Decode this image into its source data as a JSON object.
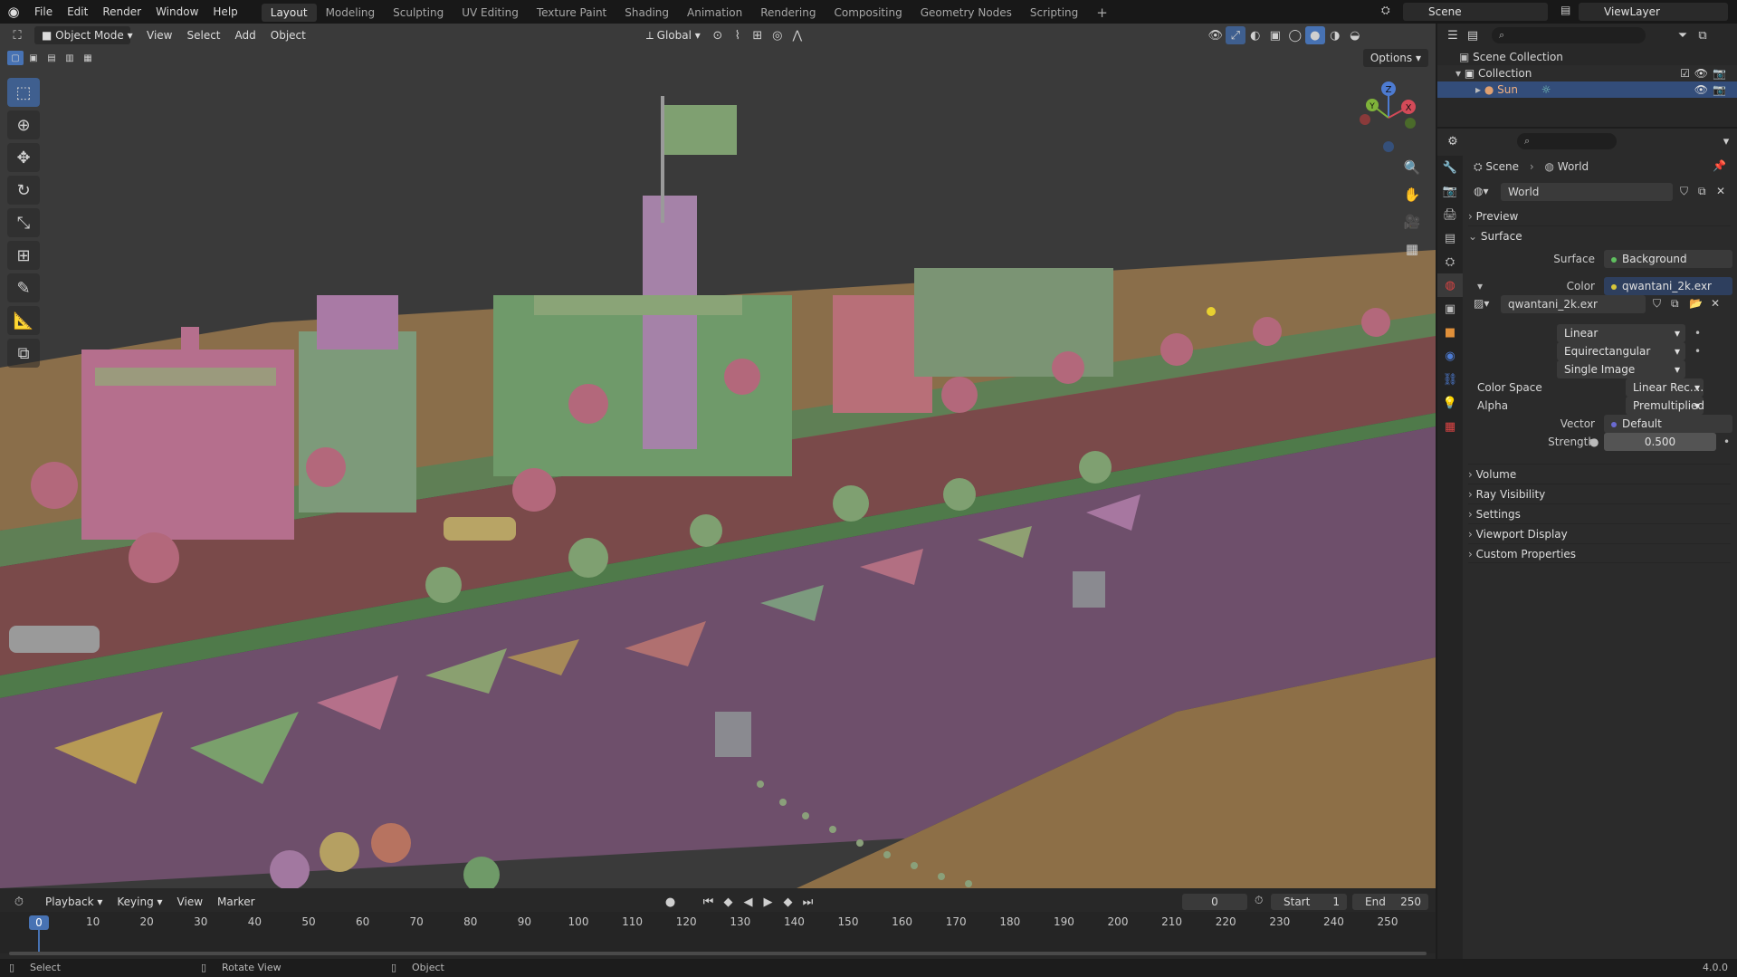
{
  "topbar": {
    "menus": [
      "File",
      "Edit",
      "Render",
      "Window",
      "Help"
    ],
    "workspaces": [
      "Layout",
      "Modeling",
      "Sculpting",
      "UV Editing",
      "Texture Paint",
      "Shading",
      "Animation",
      "Rendering",
      "Compositing",
      "Geometry Nodes",
      "Scripting"
    ],
    "active_workspace": "Layout",
    "scene_name": "Scene",
    "view_layer": "ViewLayer"
  },
  "viewport": {
    "mode": "Object Mode",
    "menus": [
      "View",
      "Select",
      "Add",
      "Object"
    ],
    "transform_orientation": "Global",
    "options_label": "Options",
    "tools": [
      "select-box",
      "cursor",
      "move",
      "rotate",
      "scale",
      "transform",
      "annotate",
      "measure",
      "add-cube"
    ],
    "nav": [
      "zoom",
      "pan",
      "camera",
      "perspective"
    ],
    "gizmo_axes": [
      "Z",
      "Y",
      "X"
    ]
  },
  "outliner": {
    "items": [
      {
        "label": "Scene Collection",
        "level": 0
      },
      {
        "label": "Collection",
        "level": 1
      },
      {
        "label": "Sun",
        "level": 2
      }
    ]
  },
  "properties": {
    "breadcrumb": [
      "Scene",
      "World"
    ],
    "world_name": "World",
    "panels": {
      "preview": "Preview",
      "surface": "Surface",
      "volume": "Volume",
      "ray_visibility": "Ray Visibility",
      "settings": "Settings",
      "viewport_display": "Viewport Display",
      "custom_properties": "Custom Properties"
    },
    "surface_label": "Surface",
    "surface_value": "Background",
    "color_label": "Color",
    "color_value": "qwantani_2k.exr",
    "image_name": "qwantani_2k.exr",
    "interpolation": "Linear",
    "projection": "Equirectangular",
    "source": "Single Image",
    "color_space_label": "Color Space",
    "color_space_value": "Linear Rec....",
    "alpha_label": "Alpha",
    "alpha_value": "Premultiplied",
    "vector_label": "Vector",
    "vector_value": "Default",
    "strength_label": "Strength",
    "strength_value": "0.500"
  },
  "timeline": {
    "menus": [
      "Playback",
      "Keying",
      "View",
      "Marker"
    ],
    "current_frame": "0",
    "start_label": "Start",
    "start_value": "1",
    "end_label": "End",
    "end_value": "250",
    "ticks": [
      "0",
      "10",
      "20",
      "30",
      "40",
      "50",
      "60",
      "70",
      "80",
      "90",
      "100",
      "110",
      "120",
      "130",
      "140",
      "150",
      "160",
      "170",
      "180",
      "190",
      "200",
      "210",
      "220",
      "230",
      "240",
      "250"
    ]
  },
  "statusbar": {
    "select": "Select",
    "rotate": "Rotate View",
    "object": "Object",
    "version": "4.0.0"
  },
  "colors": {
    "accent": "#4772b3",
    "active_tab": "#303030"
  }
}
